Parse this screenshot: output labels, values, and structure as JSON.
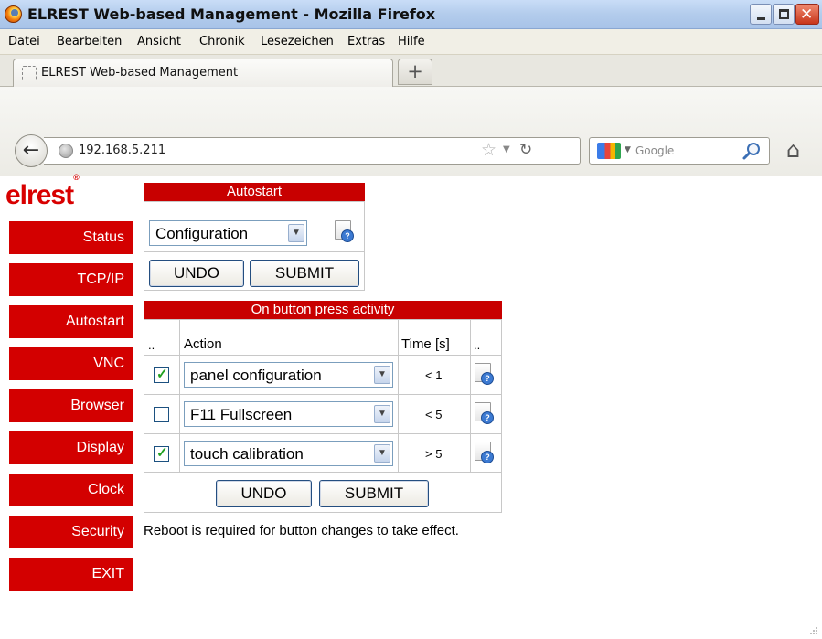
{
  "window": {
    "title": "ELREST Web-based Management - Mozilla Firefox"
  },
  "menu": {
    "items": [
      "Datei",
      "Bearbeiten",
      "Ansicht",
      "Chronik",
      "Lesezeichen",
      "Extras",
      "Hilfe"
    ]
  },
  "tabs": {
    "active_label": "ELREST Web-based Management",
    "new_tab_label": "+"
  },
  "navbar": {
    "url": "192.168.5.211",
    "search_placeholder": "Google"
  },
  "page": {
    "logo_text": "elrest",
    "logo_mark": "®",
    "nav": [
      "Status",
      "TCP/IP",
      "Autostart",
      "VNC",
      "Browser",
      "Display",
      "Clock",
      "Security",
      "EXIT"
    ],
    "autostart": {
      "header": "Autostart",
      "selected": "Configuration",
      "undo_label": "UNDO",
      "submit_label": "SUBMIT"
    },
    "button_activity": {
      "header": "On button press activity",
      "columns": [
        "..",
        "Action",
        "Time [s]",
        ".."
      ],
      "rows": [
        {
          "checked": true,
          "action": "panel configuration",
          "time": "< 1"
        },
        {
          "checked": false,
          "action": "F11 Fullscreen",
          "time": "< 5"
        },
        {
          "checked": true,
          "action": "touch calibration",
          "time": "> 5"
        }
      ],
      "undo_label": "UNDO",
      "submit_label": "SUBMIT"
    },
    "notice": "Reboot is required for button changes to take effect."
  },
  "colors": {
    "accent_red": "#d30000",
    "header_red": "#c80000"
  }
}
